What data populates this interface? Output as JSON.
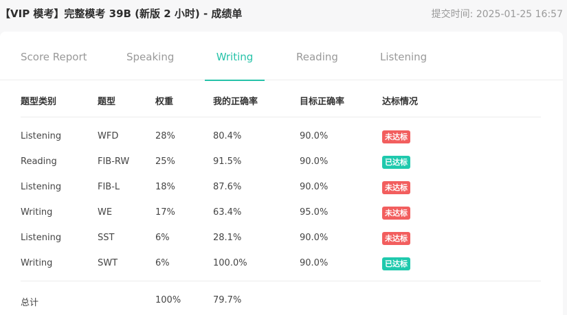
{
  "header": {
    "title": "【VIP 模考】完整模考 39B (新版 2 小时) - 成绩单",
    "submit_time": "提交时间: 2025-01-25 16:57"
  },
  "tabs": [
    {
      "label": "Score Report",
      "active": false
    },
    {
      "label": "Speaking",
      "active": false
    },
    {
      "label": "Writing",
      "active": true
    },
    {
      "label": "Reading",
      "active": false
    },
    {
      "label": "Listening",
      "active": false
    }
  ],
  "colors": {
    "accent": "#25c2a8",
    "fail_badge": "#f25e5e",
    "pass_badge": "#1fc9ad"
  },
  "table": {
    "headers": [
      "题型类别",
      "题型",
      "权重",
      "我的正确率",
      "目标正确率",
      "达标情况"
    ],
    "rows": [
      {
        "category": "Listening",
        "type": "WFD",
        "weight": "28%",
        "my_rate": "80.4%",
        "target_rate": "90.0%",
        "status": "未达标",
        "status_kind": "fail"
      },
      {
        "category": "Reading",
        "type": "FIB-RW",
        "weight": "25%",
        "my_rate": "91.5%",
        "target_rate": "90.0%",
        "status": "已达标",
        "status_kind": "pass"
      },
      {
        "category": "Listening",
        "type": "FIB-L",
        "weight": "18%",
        "my_rate": "87.6%",
        "target_rate": "90.0%",
        "status": "未达标",
        "status_kind": "fail"
      },
      {
        "category": "Writing",
        "type": "WE",
        "weight": "17%",
        "my_rate": "63.4%",
        "target_rate": "95.0%",
        "status": "未达标",
        "status_kind": "fail"
      },
      {
        "category": "Listening",
        "type": "SST",
        "weight": "6%",
        "my_rate": "28.1%",
        "target_rate": "90.0%",
        "status": "未达标",
        "status_kind": "fail"
      },
      {
        "category": "Writing",
        "type": "SWT",
        "weight": "6%",
        "my_rate": "100.0%",
        "target_rate": "90.0%",
        "status": "已达标",
        "status_kind": "pass"
      }
    ],
    "total": {
      "label": "总计",
      "weight": "100%",
      "my_rate": "79.7%"
    }
  }
}
